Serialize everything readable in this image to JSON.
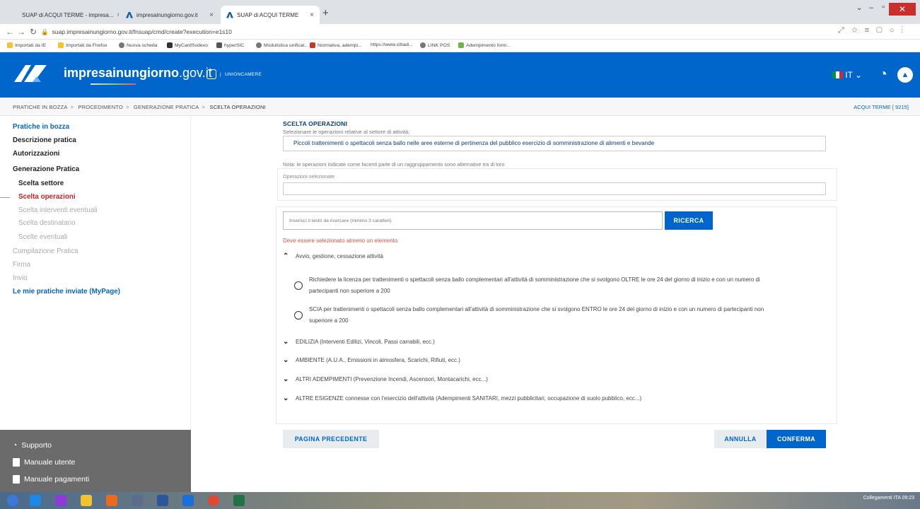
{
  "browser": {
    "tabs": [
      {
        "title": "SUAP di ACQUI TERME - impresa..."
      },
      {
        "title": "impresainungiorno.gov.it"
      },
      {
        "title": "SUAP di ACQUI TERME"
      }
    ],
    "url": "suap.impresainungiorno.gov.it/fnsuap/cmd/create?execution=e1s10",
    "bookmarks": [
      "Importati da IE",
      "Importati da Firefox",
      "Nuova scheda",
      "MyCardSodexo",
      "hyperSIC",
      "Modulistica unificat...",
      "Normativa, adempi...",
      "https://www.cittadi...",
      "LINK POS",
      "Adempimento form..."
    ]
  },
  "header": {
    "brand_bold": "impresa",
    "brand_rest": "inungiorno",
    "brand_tld": ".gov.it",
    "unioncamere": "UNIONCAMERE",
    "lang": "IT"
  },
  "breadcrumb": {
    "items": [
      "PRATICHE IN BOZZA",
      "PROCEDIMENTO",
      "GENERAZIONE PRATICA",
      "SCELTA OPERAZIONI"
    ],
    "sep": ">",
    "comune": "ACQUI TERME [ 9215]"
  },
  "sidebar": {
    "items": [
      "Pratiche in bozza",
      "Descrizione pratica",
      "Autorizzazioni",
      "Generazione Pratica",
      "Scelta settore",
      "Scelta operazioni",
      "Scelta interventi eventuali",
      "Scelta destinatario",
      "Scelte eventuali",
      "Compilazione Pratica",
      "Firma",
      "Invio",
      "Le mie pratiche inviate (MyPage)"
    ],
    "footer": [
      "Supporto",
      "Manuale utente",
      "Manuale pagamenti"
    ]
  },
  "main": {
    "title": "SCELTA OPERAZIONI",
    "subtitle": "Selezionare le operazioni relative al settore di attività:",
    "selected_sector": "Piccoli trattenimenti o spettacoli senza ballo nelle aree esterne di pertinenza del pubblico esercizio di somministrazione di alimenti e bevande",
    "note": "Nota: le operazioni indicate come facenti parte di un raggruppamento sono alternative tra di loro",
    "selected_ops_label": "Operazioni selezionate",
    "search_placeholder": "Inserisci il testo da ricercare (minimo 3 caratteri)",
    "search_button": "RICERCA",
    "error": "Deve essere selezionato almeno un elemento",
    "section_open": "Avvio, gestione, cessazione attività",
    "options": [
      "Richiedere la licenza per trattenimenti o spettacoli senza ballo complementari all'attività di somministrazione che si svolgono OLTRE le ore 24 del giorno di inizio e con un numero di partecipanti non superiore a 200",
      "SCIA per trattenimenti o spettacoli senza ballo complementari all'attività di somministrazione che si svolgono ENTRO le ore 24 del giorno di inizio e con un numero di partecipanti non superiore a 200"
    ],
    "sections_closed": [
      "EDILIZIA (Interventi Edilizi, Vincoli, Passi carrabili, ecc.)",
      "AMBIENTE (A.U.A., Emissioni in atmosfera, Scarichi, Rifiuti, ecc.)",
      "ALTRI ADEMPIMENTI (Prevenzione Incendi, Ascensori, Montacarichi, ecc...)",
      "ALTRE ESIGENZE connesse con l'esercizio dell'attività (Adempimenti SANITARI, mezzi pubblicitari, occupazione di suolo pubblico, ecc...)"
    ],
    "btn_prev": "PAGINA PRECEDENTE",
    "btn_cancel": "ANNULLA",
    "btn_confirm": "CONFERMA"
  },
  "taskbar": {
    "tray": "Collegamenti  ITA  09:23"
  }
}
